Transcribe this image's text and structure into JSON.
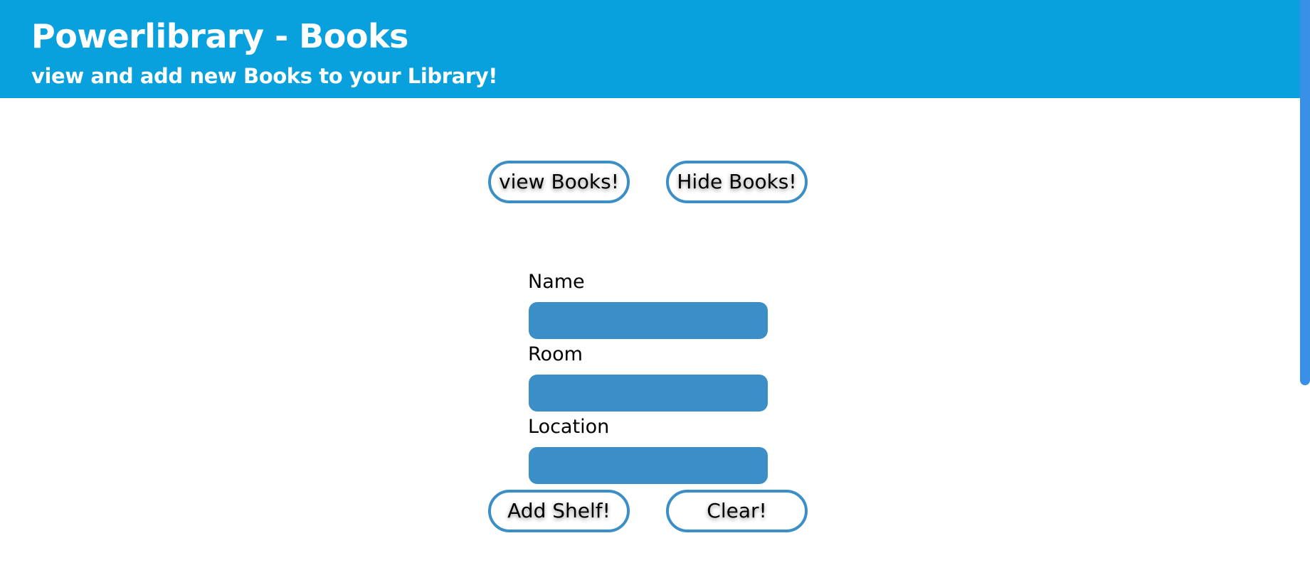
{
  "header": {
    "title": "Powerlibrary - Books",
    "subtitle": "view and add new Books to your Library!"
  },
  "actions": {
    "view_books": "view Books!",
    "hide_books": "Hide Books!"
  },
  "form": {
    "name_label": "Name",
    "name_value": "",
    "room_label": "Room",
    "room_value": "",
    "location_label": "Location",
    "location_value": "",
    "add_shelf": "Add Shelf!",
    "clear": "Clear!"
  },
  "colors": {
    "header_bg": "#08a0dd",
    "accent": "#3c8ec7",
    "scrollbar": "#3a8fe6"
  }
}
